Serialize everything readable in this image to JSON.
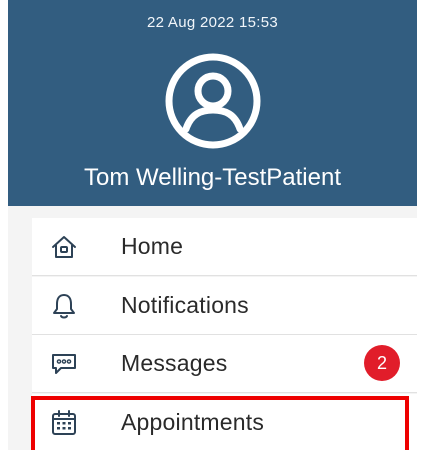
{
  "status": {
    "timestamp": "22 Aug 2022 15:53"
  },
  "profile": {
    "name": "Tom Welling-TestPatient",
    "avatar_icon": "user-circle-icon"
  },
  "menu": {
    "items": [
      {
        "label": "Home",
        "icon": "home-icon"
      },
      {
        "label": "Notifications",
        "icon": "bell-icon"
      },
      {
        "label": "Messages",
        "icon": "chat-bubble-icon",
        "badge": "2"
      },
      {
        "label": "Appointments",
        "icon": "calendar-icon"
      }
    ]
  },
  "colors": {
    "header_bg": "#325d80",
    "badge_bg": "#e11d2a",
    "highlight": "#ee0000",
    "icon_stroke": "#2d4256"
  }
}
